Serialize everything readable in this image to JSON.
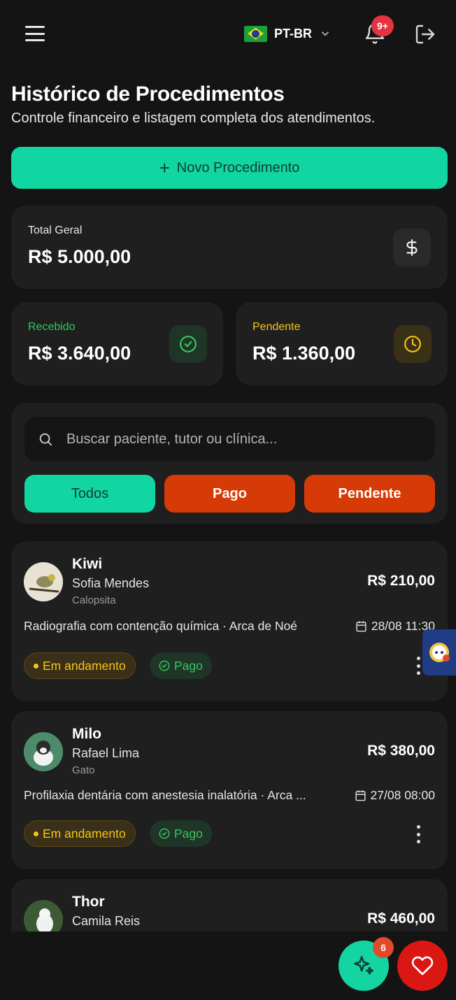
{
  "header": {
    "menu_icon": "hamburger-icon",
    "language": "PT-BR",
    "flag_icon": "brazil-flag-icon",
    "notifications_badge": "9+",
    "logout_icon": "logout-icon"
  },
  "page": {
    "title": "Histórico de Procedimentos",
    "subtitle": "Controle financeiro e listagem completa dos atendimentos.",
    "new_button_label": "Novo Procedimento"
  },
  "stats": {
    "total": {
      "label": "Total Geral",
      "value": "R$ 5.000,00",
      "icon": "dollar-icon"
    },
    "received": {
      "label": "Recebido",
      "value": "R$ 3.640,00",
      "icon": "check-circle-icon",
      "color": "#36c65f"
    },
    "pending": {
      "label": "Pendente",
      "value": "R$ 1.360,00",
      "icon": "clock-icon",
      "color": "#f5c518"
    }
  },
  "search": {
    "placeholder": "Buscar paciente, tutor ou clínica...",
    "value": ""
  },
  "filters": [
    {
      "label": "Todos",
      "active": true,
      "color": "#12d6a2"
    },
    {
      "label": "Pago",
      "active": false,
      "color": "#d63a06"
    },
    {
      "label": "Pendente",
      "active": false,
      "color": "#d63a06"
    }
  ],
  "procedures": [
    {
      "pet": "Kiwi",
      "tutor": "Sofia Mendes",
      "species": "Calopsita",
      "price": "R$ 210,00",
      "description": "Radiografia com contenção química · Arca de Noé",
      "date": "28/08 11:30",
      "status": "Em andamento",
      "payment": "Pago"
    },
    {
      "pet": "Milo",
      "tutor": "Rafael Lima",
      "species": "Gato",
      "price": "R$ 380,00",
      "description": "Profilaxia dentária com anestesia inalatória · Arca ...",
      "date": "27/08 08:00",
      "status": "Em andamento",
      "payment": "Pago"
    },
    {
      "pet": "Thor",
      "tutor": "Camila Reis",
      "species": "",
      "price": "R$ 460,00"
    }
  ],
  "fabs": {
    "ai_badge": "6",
    "ai_icon": "sparkles-icon",
    "heart_icon": "heart-icon"
  },
  "colors": {
    "accent": "#12d6a2",
    "danger": "#d63a06",
    "card": "#1f1f1f",
    "background": "#141414"
  }
}
